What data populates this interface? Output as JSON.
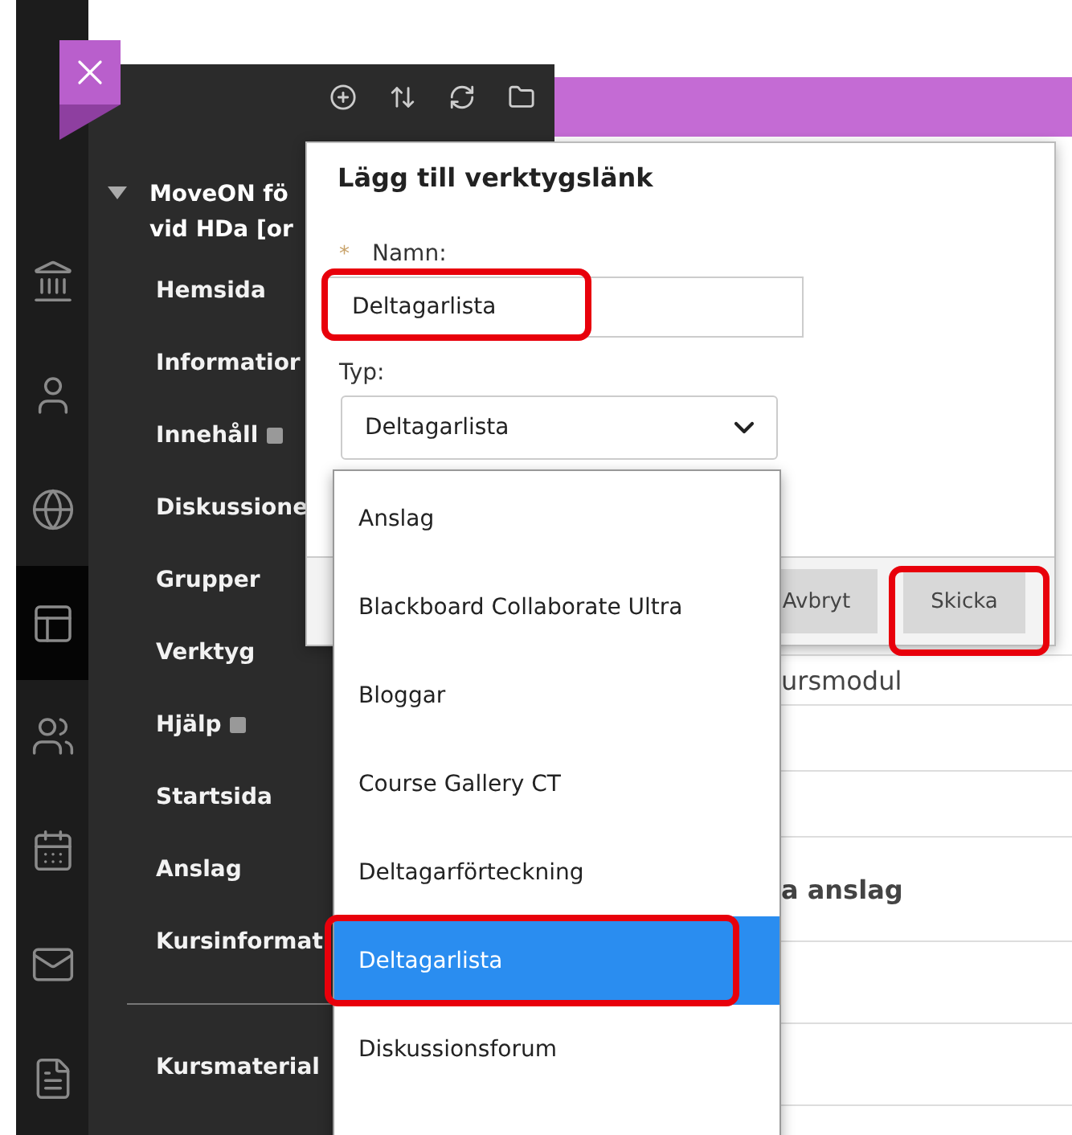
{
  "rail": {
    "items": [
      {
        "kind": "institution",
        "selected": false
      },
      {
        "kind": "person",
        "selected": false
      },
      {
        "kind": "globe",
        "selected": false
      },
      {
        "kind": "course",
        "selected": true
      },
      {
        "kind": "groups",
        "selected": false
      },
      {
        "kind": "calendar",
        "selected": false
      },
      {
        "kind": "mail",
        "selected": false
      },
      {
        "kind": "document",
        "selected": false
      }
    ]
  },
  "course_menu": {
    "title_lines": [
      "MoveON fö",
      "vid HDa [or"
    ],
    "items": [
      {
        "label": "Hemsida",
        "marked": false
      },
      {
        "label": "Informatior"
      },
      {
        "label": "Innehåll",
        "marked": true
      },
      {
        "label": "Diskussione"
      },
      {
        "label": "Grupper",
        "marked": false
      },
      {
        "label": "Verktyg",
        "marked": false
      },
      {
        "label": "Hjälp",
        "marked": true
      },
      {
        "label": "Startsida",
        "marked": false
      },
      {
        "label": "Anslag",
        "marked": false
      },
      {
        "label": "Kursinformat",
        "marked": false
      }
    ],
    "lower_items": [
      {
        "label": "Kursmaterial",
        "marked": false
      }
    ]
  },
  "content": {
    "rows": [
      "ursmodul",
      "a anslag"
    ]
  },
  "dialog": {
    "title": "Lägg till verktygslänk",
    "required_mark": "*",
    "name_label": "Namn:",
    "name_value": "Deltagarlista",
    "type_label": "Typ:",
    "type_value": "Deltagarlista",
    "options": [
      {
        "label": "Anslag",
        "selected": false
      },
      {
        "label": "Blackboard Collaborate Ultra",
        "selected": false
      },
      {
        "label": "Bloggar",
        "selected": false
      },
      {
        "label": "Course Gallery CT",
        "selected": false
      },
      {
        "label": "Deltagarförteckning",
        "selected": false
      },
      {
        "label": "Deltagarlista",
        "selected": true
      },
      {
        "label": "Diskussionsforum",
        "selected": false
      }
    ],
    "buttons": [
      "Avbryt",
      "Skicka"
    ]
  }
}
